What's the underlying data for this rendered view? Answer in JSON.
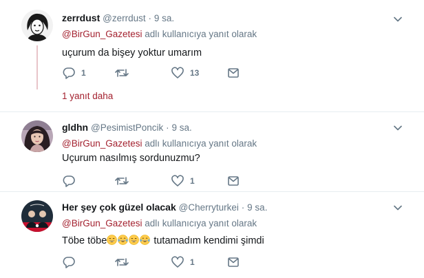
{
  "tweets": [
    {
      "name": "zerrdust",
      "handle": "@zerrdust",
      "dot": "·",
      "time": "9 sa.",
      "mention": "@BirGun_Gazetesi",
      "reply_suffix": "adlı kullanıcıya yanıt olarak",
      "text": "uçurum da bişey yoktur umarım",
      "reply_count": "1",
      "retweet_count": "",
      "like_count": "13",
      "more_replies": "1 yanıt daha"
    },
    {
      "name": "gldhn",
      "handle": "@PesimistPoncik",
      "dot": "·",
      "time": "9 sa.",
      "mention": "@BirGun_Gazetesi",
      "reply_suffix": "adlı kullanıcıya yanıt olarak",
      "text": "Uçurum nasılmış sordunuzmu?",
      "reply_count": "",
      "retweet_count": "",
      "like_count": "1"
    },
    {
      "name": "Her şey çok güzel olacak",
      "handle": "@Cherryturkei",
      "dot": "·",
      "time": "9 sa.",
      "mention": "@BirGun_Gazetesi",
      "reply_suffix": "adlı kullanıcıya yanıt olarak",
      "text_before": "Töbe töbe",
      "text_after": "tutamadım kendimi şimdi",
      "emojis": [
        "grinning-face-smiling-eyes",
        "face-tears-of-joy",
        "grinning-face-smiling-eyes",
        "face-tears-of-joy"
      ],
      "reply_count": "",
      "retweet_count": "",
      "like_count": "1"
    }
  ],
  "colors": {
    "mention": "#a3202e",
    "thread_line": "#e8c4c9",
    "muted": "#657786",
    "icon": "#657786"
  },
  "icons": [
    "reply-icon",
    "retweet-icon",
    "like-icon",
    "direct-message-icon",
    "chevron-down-icon"
  ]
}
